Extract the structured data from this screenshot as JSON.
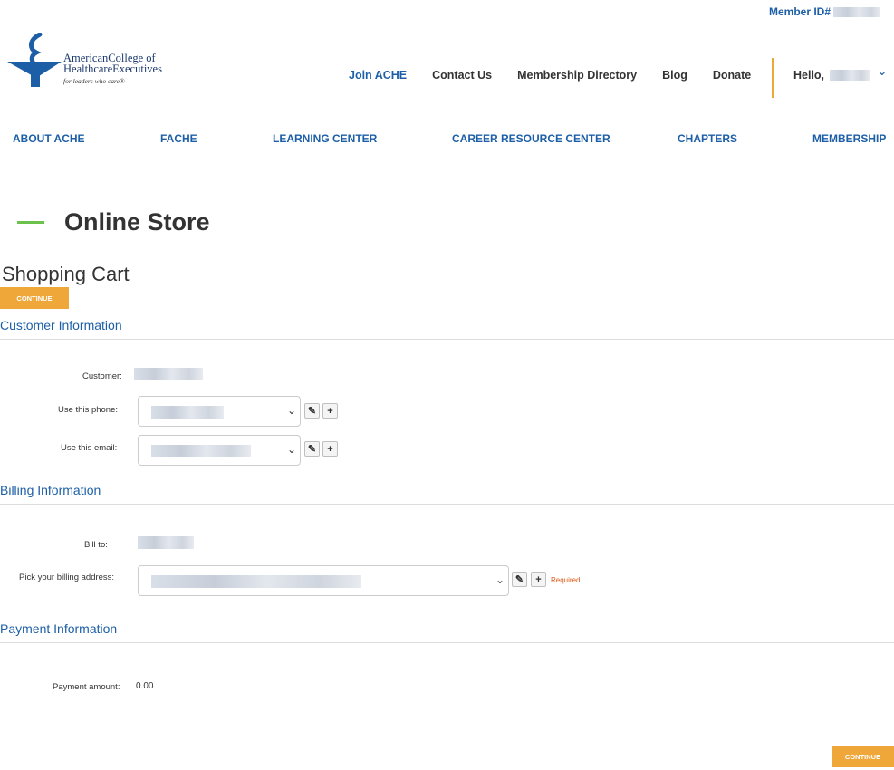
{
  "header": {
    "member_id_label": "Member ID#",
    "logo": {
      "line1": "AmericanCollege of",
      "line2": "HealthcareExecutives",
      "tagline": "for leaders who care®"
    },
    "top_nav": [
      "Join ACHE",
      "Contact Us",
      "Membership Directory",
      "Blog",
      "Donate"
    ],
    "hello_label": "Hello,"
  },
  "main_nav": [
    "ABOUT ACHE",
    "FACHE",
    "LEARNING CENTER",
    "CAREER RESOURCE CENTER",
    "CHAPTERS",
    "MEMBERSHIP"
  ],
  "page": {
    "title": "Online Store",
    "cart_title": "Shopping Cart",
    "continue_label": "CONTINUE"
  },
  "customer_info": {
    "title": "Customer Information",
    "customer_label": "Customer:",
    "phone_label": "Use this phone:",
    "email_label": "Use this email:"
  },
  "billing_info": {
    "title": "Billing Information",
    "bill_to_label": "Bill to:",
    "address_label": "Pick your billing address:",
    "required_label": "Required"
  },
  "payment_info": {
    "title": "Payment Information",
    "amount_label": "Payment amount:",
    "amount_value": "0.00"
  },
  "colors": {
    "accent_blue": "#1d5fa7",
    "button_orange": "#f0a73a",
    "title_dash_green": "#6cc24a",
    "required_orange": "#e05a1a"
  },
  "icons": [
    "chevron-down-icon",
    "pencil-icon",
    "plus-icon"
  ]
}
